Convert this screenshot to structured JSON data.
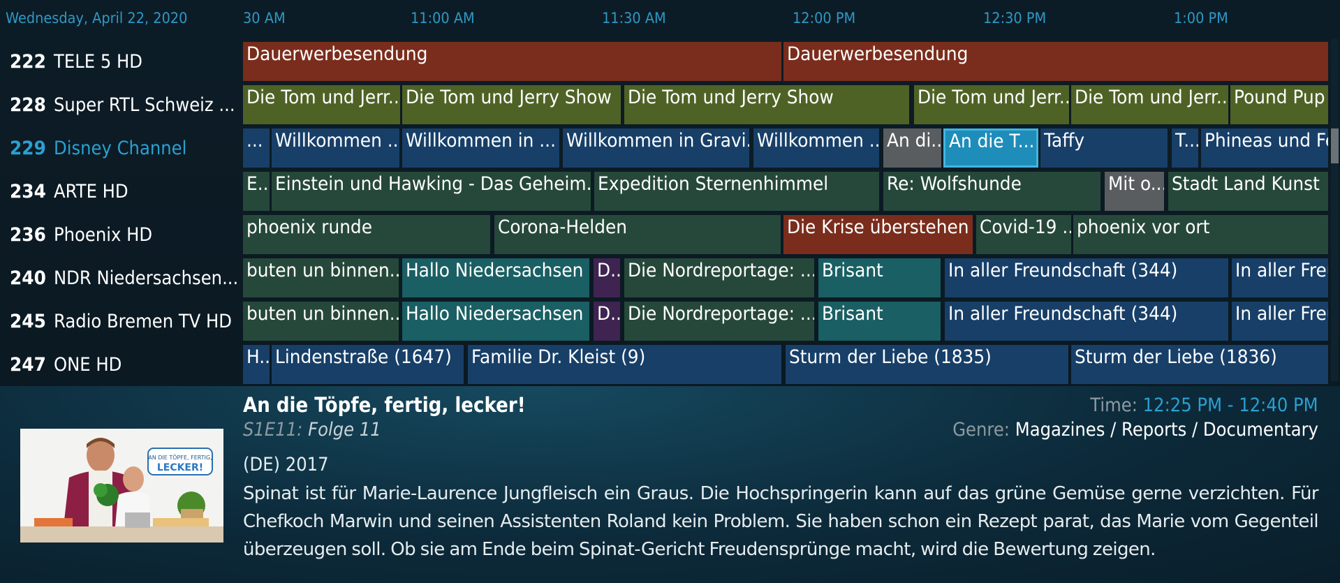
{
  "epg": {
    "date": "Wednesday, April 22, 2020",
    "timeline": [
      "30 AM",
      "11:00 AM",
      "11:30 AM",
      "12:00 PM",
      "12:30 PM",
      "1:00 PM"
    ],
    "channels": [
      {
        "number": "222",
        "name": "TELE 5 HD"
      },
      {
        "number": "228",
        "name": "Super RTL Schweiz ..."
      },
      {
        "number": "229",
        "name": "Disney Channel"
      },
      {
        "number": "234",
        "name": "ARTE HD"
      },
      {
        "number": "236",
        "name": "Phoenix HD"
      },
      {
        "number": "240",
        "name": "NDR Niedersachsen..."
      },
      {
        "number": "245",
        "name": "Radio Bremen TV HD"
      },
      {
        "number": "247",
        "name": "ONE HD"
      }
    ],
    "selected_channel": "229",
    "rows": [
      [
        {
          "title": "Dauerwerbesendung",
          "color": "red"
        },
        {
          "title": "Dauerwerbesendung",
          "color": "red"
        }
      ],
      [
        {
          "title": "Die Tom und Jerr...",
          "color": "olive"
        },
        {
          "title": "Die Tom und Jerry Show",
          "color": "olive"
        },
        {
          "title": "Die Tom und Jerry Show",
          "color": "olive"
        },
        {
          "title": "Die Tom und Jerr...",
          "color": "olive"
        },
        {
          "title": "Die Tom und Jerr...",
          "color": "olive"
        },
        {
          "title": "Pound Pup",
          "color": "olive"
        }
      ],
      [
        {
          "title": "...",
          "color": "blue"
        },
        {
          "title": "Willkommen ...",
          "color": "blue"
        },
        {
          "title": "Willkommen in ...",
          "color": "blue"
        },
        {
          "title": "Willkommen in Gravi...",
          "color": "blue"
        },
        {
          "title": "Willkommen ...",
          "color": "blue"
        },
        {
          "title": "An di...",
          "color": "gray"
        },
        {
          "title": "An die T...",
          "color": "focused"
        },
        {
          "title": "Taffy",
          "color": "blue"
        },
        {
          "title": "T...",
          "color": "blue"
        },
        {
          "title": "Phineas und Fe",
          "color": "blue"
        }
      ],
      [
        {
          "title": "E...",
          "color": "green"
        },
        {
          "title": "Einstein und Hawking - Das Geheim...",
          "color": "green"
        },
        {
          "title": "Expedition Sternenhimmel",
          "color": "green"
        },
        {
          "title": "Re: Wolfshunde",
          "color": "green"
        },
        {
          "title": "Mit o...",
          "color": "gray"
        },
        {
          "title": "Stadt Land Kunst",
          "color": "green"
        }
      ],
      [
        {
          "title": "phoenix runde",
          "color": "green"
        },
        {
          "title": "Corona-Helden",
          "color": "green"
        },
        {
          "title": "Die Krise überstehen",
          "color": "red"
        },
        {
          "title": "Covid-19 ...",
          "color": "green"
        },
        {
          "title": "phoenix vor ort",
          "color": "green"
        }
      ],
      [
        {
          "title": "buten un binnen...",
          "color": "green"
        },
        {
          "title": "Hallo Niedersachsen",
          "color": "teal"
        },
        {
          "title": "D...",
          "color": "purple"
        },
        {
          "title": "Die Nordreportage: ...",
          "color": "green"
        },
        {
          "title": "Brisant",
          "color": "teal"
        },
        {
          "title": "In aller Freundschaft (344)",
          "color": "blue"
        },
        {
          "title": "In aller Freu",
          "color": "blue"
        }
      ],
      [
        {
          "title": "buten un binnen...",
          "color": "green"
        },
        {
          "title": "Hallo Niedersachsen",
          "color": "teal"
        },
        {
          "title": "D...",
          "color": "purple"
        },
        {
          "title": "Die Nordreportage: ...",
          "color": "green"
        },
        {
          "title": "Brisant",
          "color": "teal"
        },
        {
          "title": "In aller Freundschaft (344)",
          "color": "blue"
        },
        {
          "title": "In aller Freu",
          "color": "blue"
        }
      ],
      [
        {
          "title": "H...",
          "color": "blue"
        },
        {
          "title": "Lindenstraße (1647)",
          "color": "blue"
        },
        {
          "title": "Familie Dr. Kleist (9)",
          "color": "blue"
        },
        {
          "title": "Sturm der Liebe (1835)",
          "color": "blue"
        },
        {
          "title": "Sturm der Liebe (1836)",
          "color": "blue"
        }
      ]
    ]
  },
  "details": {
    "title": "An die Töpfe, fertig, lecker!",
    "episode_code": "S1E11:",
    "episode_title": "Folge 11",
    "time_label": "Time:",
    "time_value": "12:25 PM - 12:40 PM",
    "genre_label": "Genre:",
    "genre_value": "Magazines / Reports / Documentary",
    "year": "(DE) 2017",
    "plot": "Spinat ist für Marie-Laurence Jungfleisch ein Graus. Die Hochspringerin kann auf das grüne Gemüse gerne verzichten. Für Chefkoch Marwin und seinen Assistenten Roland kein Problem. Sie haben schon ein Rezept parat, das Marie vom Gegenteil überzeugen soll. Ob sie am Ende beim Spinat-Gericht Freudensprünge macht, wird die Bewertung zeigen.",
    "thumbnail_icon": "show-thumbnail-image",
    "thumbnail_logo_text": "AN DIE TÖPFE, FERTIG, LECKER!"
  },
  "colors": {
    "accent": "#2aa0d2",
    "red": "#7a2d1c",
    "olive": "#4f6226",
    "blue": "#173f68",
    "green": "#26483a",
    "gray": "#595d60",
    "teal": "#1a5f63",
    "purple": "#3f2452",
    "focused": "#1e8dba"
  }
}
